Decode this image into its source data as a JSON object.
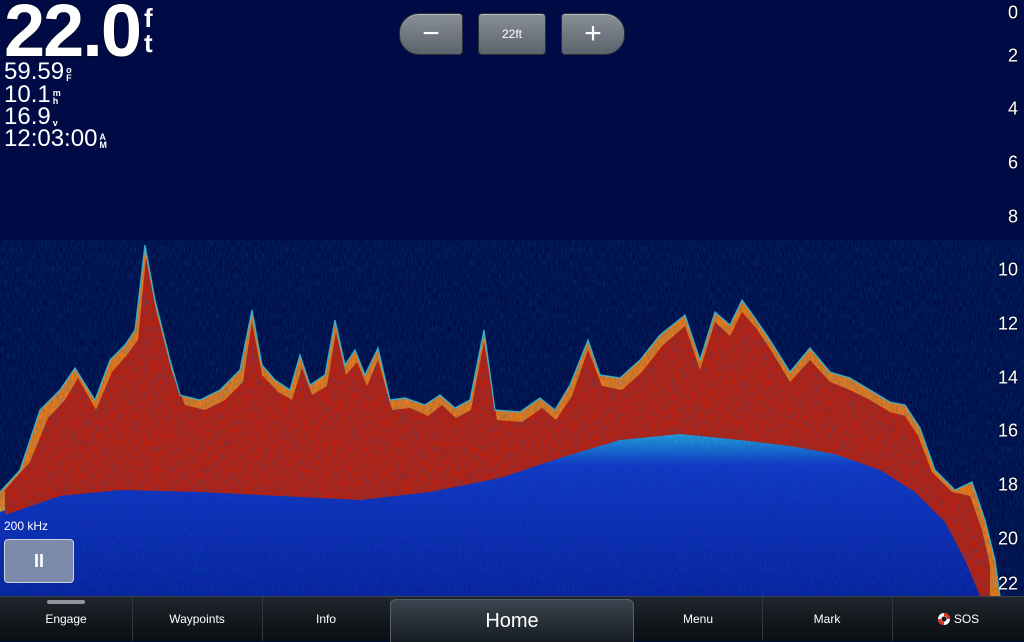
{
  "readouts": {
    "depth": {
      "value": "22.0",
      "unit_top": "f",
      "unit_bottom": "t"
    },
    "water_temp": {
      "value": "59.59",
      "unit_top": "o",
      "unit_bottom": "F"
    },
    "speed": {
      "value": "10.1",
      "unit_top": "m",
      "unit_bottom": "h"
    },
    "voltage": {
      "value": "16.9",
      "unit_top": "",
      "unit_bottom": "v"
    },
    "time": {
      "value": "12:03:00",
      "unit_top": "A",
      "unit_bottom": "M"
    }
  },
  "zoom": {
    "minus_label": "−",
    "level_label": "22ft",
    "plus_label": "+"
  },
  "depth_scale": [
    "0",
    "2",
    "4",
    "6",
    "8",
    "10",
    "12",
    "14",
    "16",
    "18",
    "20",
    "22"
  ],
  "frequency_label": "200 kHz",
  "pause_label": "II",
  "bottom_bar": {
    "engage": "Engage",
    "waypoints": "Waypoints",
    "info": "Info",
    "home": "Home",
    "menu": "Menu",
    "mark": "Mark",
    "sos": "SOS"
  },
  "colors": {
    "water": "#000b45",
    "echo_strong": "#c21d08",
    "echo_medium": "#f07b14",
    "echo_weak": "#f0e21e",
    "echo_faint": "#2bc4e6",
    "bottom_return": "#1434c8"
  }
}
